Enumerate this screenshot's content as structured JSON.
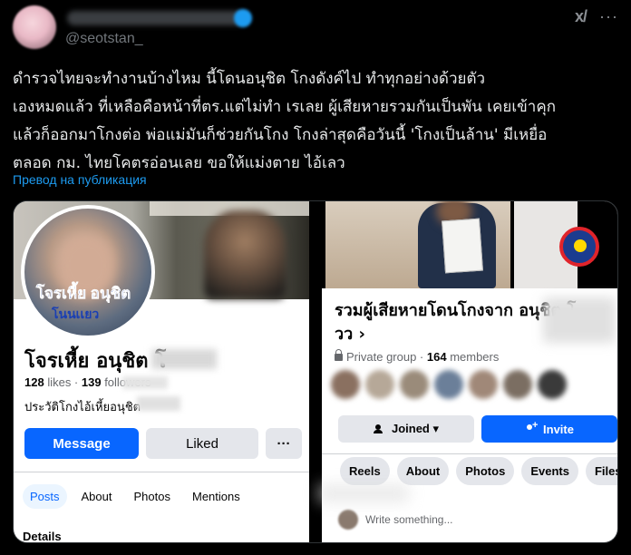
{
  "tweet": {
    "handle": "@seotstan_",
    "body": "ดำรวจไทยจะทำงานบ้างไหม นี้โดนอนุชิต          โกงดังค์ไป ทำทุกอย่างด้วยตัว\nเองหมดแล้ว ที่เหลือคือหน้าที่ตร.แต่ไม่ทำ เรเลย ผู้เสียหายรวมกันเป็นพัน เคยเข้าคุก\nแล้วก็ออกมาโกงต่อ พ่อแม่มันก็ช่วยกันโกง โกงล่าสุดคือวันนี้ 'โกงเป็นล้าน' มีเหยื่อ\nตลอด กม. ไทยโคตรอ่อนเลย ขอให้แม่งตาย ไอ้เลว",
    "translate_link": "Превод на публикация",
    "icons": {
      "grok": "grok-icon",
      "more": "more-icon"
    }
  },
  "left_panel": {
    "avatar_caption": "โจรเหี้ย อนุชิต",
    "avatar_caption2": "โนนเเยว",
    "profile_name": "โจรเหี้ย อนุชิต โ",
    "likes_count": "128",
    "likes_label": " likes · ",
    "followers_count": "139",
    "followers_label": " followers",
    "bio": "ประวัติโกงไอ้เหี้ยอนุชิต",
    "message_button": "Message",
    "liked_button": "Liked",
    "more_button": "···",
    "tabs": [
      "Posts",
      "About",
      "Photos",
      "Mentions"
    ],
    "details": "Details"
  },
  "right_panel": {
    "group_title": "รวมผู้เสียหายโดนโกงจาก อนุชิต โ\nวว ›",
    "privacy": "Private group · ",
    "members_count": "164",
    "members_label": " members",
    "joined_button": "Joined ▾",
    "invite_button": "Invite",
    "chips": [
      "Reels",
      "About",
      "Photos",
      "Events",
      "Files"
    ],
    "write_placeholder": "Write something..."
  },
  "colors": {
    "fb_blue": "#0866ff",
    "x_blue": "#1d9bf0",
    "background": "#000000"
  }
}
